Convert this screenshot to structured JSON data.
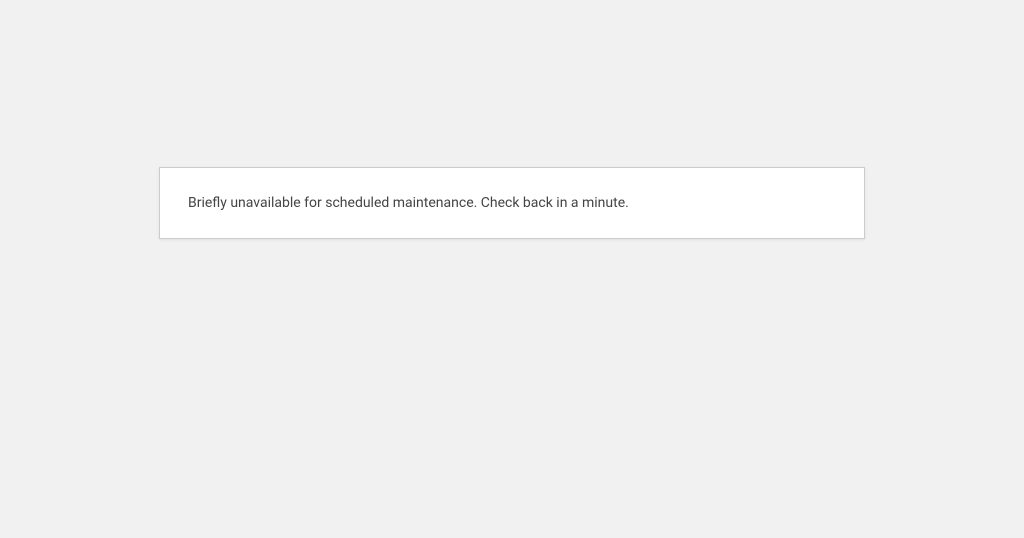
{
  "maintenance": {
    "message": "Briefly unavailable for scheduled maintenance. Check back in a minute."
  }
}
